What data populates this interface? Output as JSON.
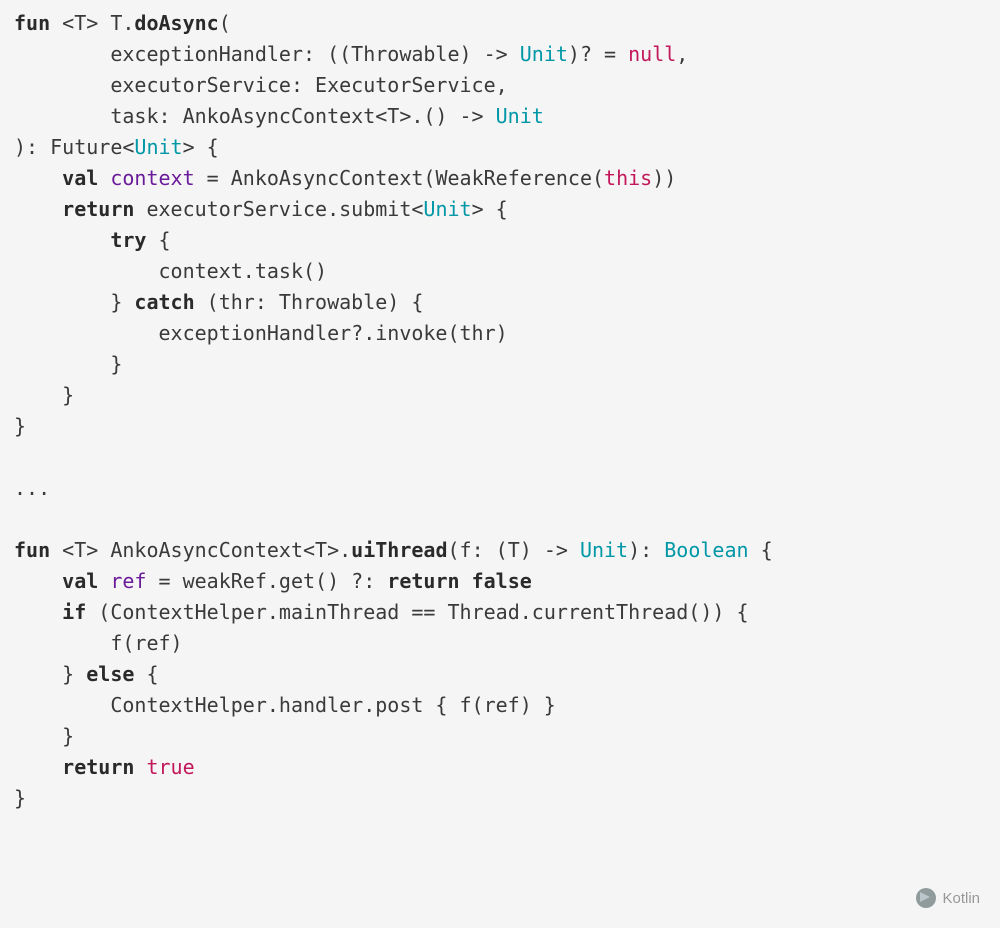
{
  "code": {
    "tokens": [
      [
        {
          "t": "fun ",
          "c": "kw-dark"
        },
        {
          "t": "<T> T.",
          "c": "ident"
        },
        {
          "t": "doAsync",
          "c": "name-bold"
        },
        {
          "t": "(",
          "c": "punc"
        }
      ],
      [
        {
          "t": "        exceptionHandler: ((Throwable) -> ",
          "c": "ident"
        },
        {
          "t": "Unit",
          "c": "type-teal"
        },
        {
          "t": ")? = ",
          "c": "ident"
        },
        {
          "t": "null",
          "c": "kw-pink"
        },
        {
          "t": ",",
          "c": "punc"
        }
      ],
      [
        {
          "t": "        executorService: ExecutorService,",
          "c": "ident"
        }
      ],
      [
        {
          "t": "        task: AnkoAsyncContext<T>.() -> ",
          "c": "ident"
        },
        {
          "t": "Unit",
          "c": "type-teal"
        }
      ],
      [
        {
          "t": "): Future<",
          "c": "ident"
        },
        {
          "t": "Unit",
          "c": "type-teal"
        },
        {
          "t": "> {",
          "c": "punc"
        }
      ],
      [
        {
          "t": "    ",
          "c": "ident"
        },
        {
          "t": "val ",
          "c": "kw-dark"
        },
        {
          "t": "context",
          "c": "fn-purple"
        },
        {
          "t": " = AnkoAsyncContext(WeakReference(",
          "c": "ident"
        },
        {
          "t": "this",
          "c": "kw-pink"
        },
        {
          "t": "))",
          "c": "punc"
        }
      ],
      [
        {
          "t": "    ",
          "c": "ident"
        },
        {
          "t": "return ",
          "c": "kw-dark"
        },
        {
          "t": "executorService.submit<",
          "c": "ident"
        },
        {
          "t": "Unit",
          "c": "type-teal"
        },
        {
          "t": "> {",
          "c": "punc"
        }
      ],
      [
        {
          "t": "        ",
          "c": "ident"
        },
        {
          "t": "try ",
          "c": "kw-dark"
        },
        {
          "t": "{",
          "c": "punc"
        }
      ],
      [
        {
          "t": "            context.task()",
          "c": "ident"
        }
      ],
      [
        {
          "t": "        } ",
          "c": "punc"
        },
        {
          "t": "catch ",
          "c": "kw-dark"
        },
        {
          "t": "(thr: Throwable) {",
          "c": "ident"
        }
      ],
      [
        {
          "t": "            exceptionHandler?.invoke(thr)",
          "c": "ident"
        }
      ],
      [
        {
          "t": "        }",
          "c": "punc"
        }
      ],
      [
        {
          "t": "    }",
          "c": "punc"
        }
      ],
      [
        {
          "t": "}",
          "c": "punc"
        }
      ],
      [
        {
          "t": "",
          "c": "ident"
        }
      ],
      [
        {
          "t": "...",
          "c": "ident"
        }
      ],
      [
        {
          "t": "",
          "c": "ident"
        }
      ],
      [
        {
          "t": "fun ",
          "c": "kw-dark"
        },
        {
          "t": "<T> AnkoAsyncContext<T>.",
          "c": "ident"
        },
        {
          "t": "uiThread",
          "c": "name-bold"
        },
        {
          "t": "(f: (T) -> ",
          "c": "ident"
        },
        {
          "t": "Unit",
          "c": "type-teal"
        },
        {
          "t": "): ",
          "c": "ident"
        },
        {
          "t": "Boolean",
          "c": "type-teal"
        },
        {
          "t": " {",
          "c": "punc"
        }
      ],
      [
        {
          "t": "    ",
          "c": "ident"
        },
        {
          "t": "val ",
          "c": "kw-dark"
        },
        {
          "t": "ref",
          "c": "fn-purple"
        },
        {
          "t": " = weakRef.get() ?: ",
          "c": "ident"
        },
        {
          "t": "return false",
          "c": "kw-dark"
        }
      ],
      [
        {
          "t": "    ",
          "c": "ident"
        },
        {
          "t": "if ",
          "c": "kw-dark"
        },
        {
          "t": "(ContextHelper.mainThread == Thread.currentThread()) {",
          "c": "ident"
        }
      ],
      [
        {
          "t": "        f(ref)",
          "c": "ident"
        }
      ],
      [
        {
          "t": "    } ",
          "c": "punc"
        },
        {
          "t": "else ",
          "c": "kw-dark"
        },
        {
          "t": "{",
          "c": "punc"
        }
      ],
      [
        {
          "t": "        ContextHelper.handler.post { f(ref) }",
          "c": "ident"
        }
      ],
      [
        {
          "t": "    }",
          "c": "punc"
        }
      ],
      [
        {
          "t": "    ",
          "c": "ident"
        },
        {
          "t": "return ",
          "c": "kw-dark"
        },
        {
          "t": "true",
          "c": "kw-pink"
        }
      ],
      [
        {
          "t": "}",
          "c": "punc"
        }
      ]
    ]
  },
  "watermark": {
    "label": "Kotlin"
  }
}
